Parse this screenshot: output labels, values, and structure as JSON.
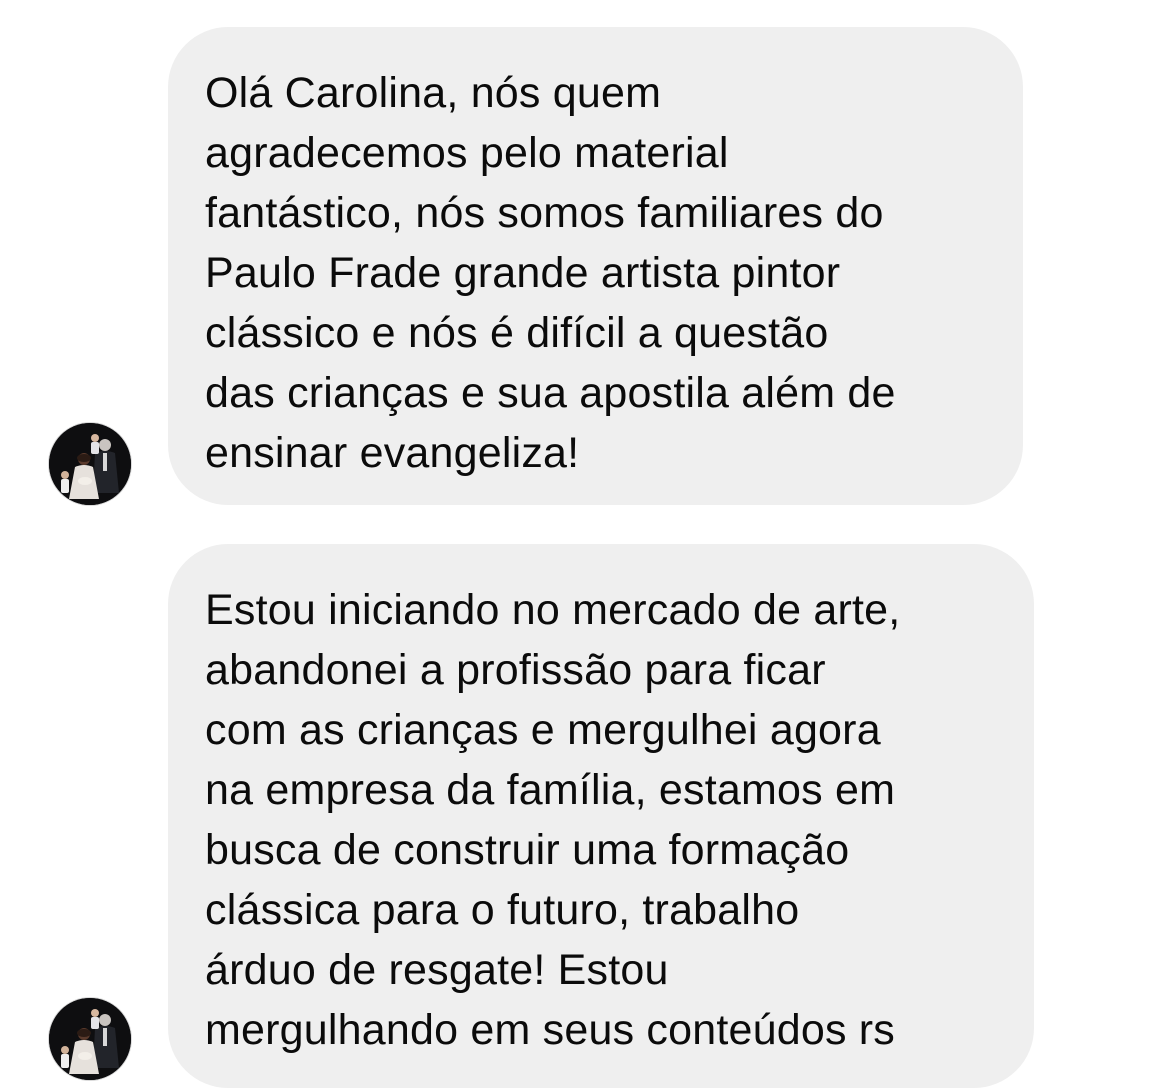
{
  "messages": [
    {
      "lines": [
        "Olá Carolina, nós quem",
        "agradecemos pelo material",
        "fantástico, nós somos familiares do",
        "Paulo Frade grande artista pintor",
        "clássico e nós é difícil a questão",
        "das crianças e sua apostila além de",
        "ensinar evangeliza!"
      ]
    },
    {
      "lines": [
        "Estou iniciando no mercado de arte,",
        "abandonei a profissão para ficar",
        "com as crianças e mergulhei agora",
        "na empresa da família, estamos em",
        "busca de construir uma formação",
        "clássica para o futuro, trabalho",
        "árduo de resgate! Estou",
        "mergulhando em seus conteúdos rs"
      ]
    }
  ],
  "colors": {
    "bubble_background": "#efefef",
    "text": "#0b0b0b",
    "page_background": "#ffffff"
  },
  "avatar": {
    "icon": "family-photo-avatar"
  }
}
